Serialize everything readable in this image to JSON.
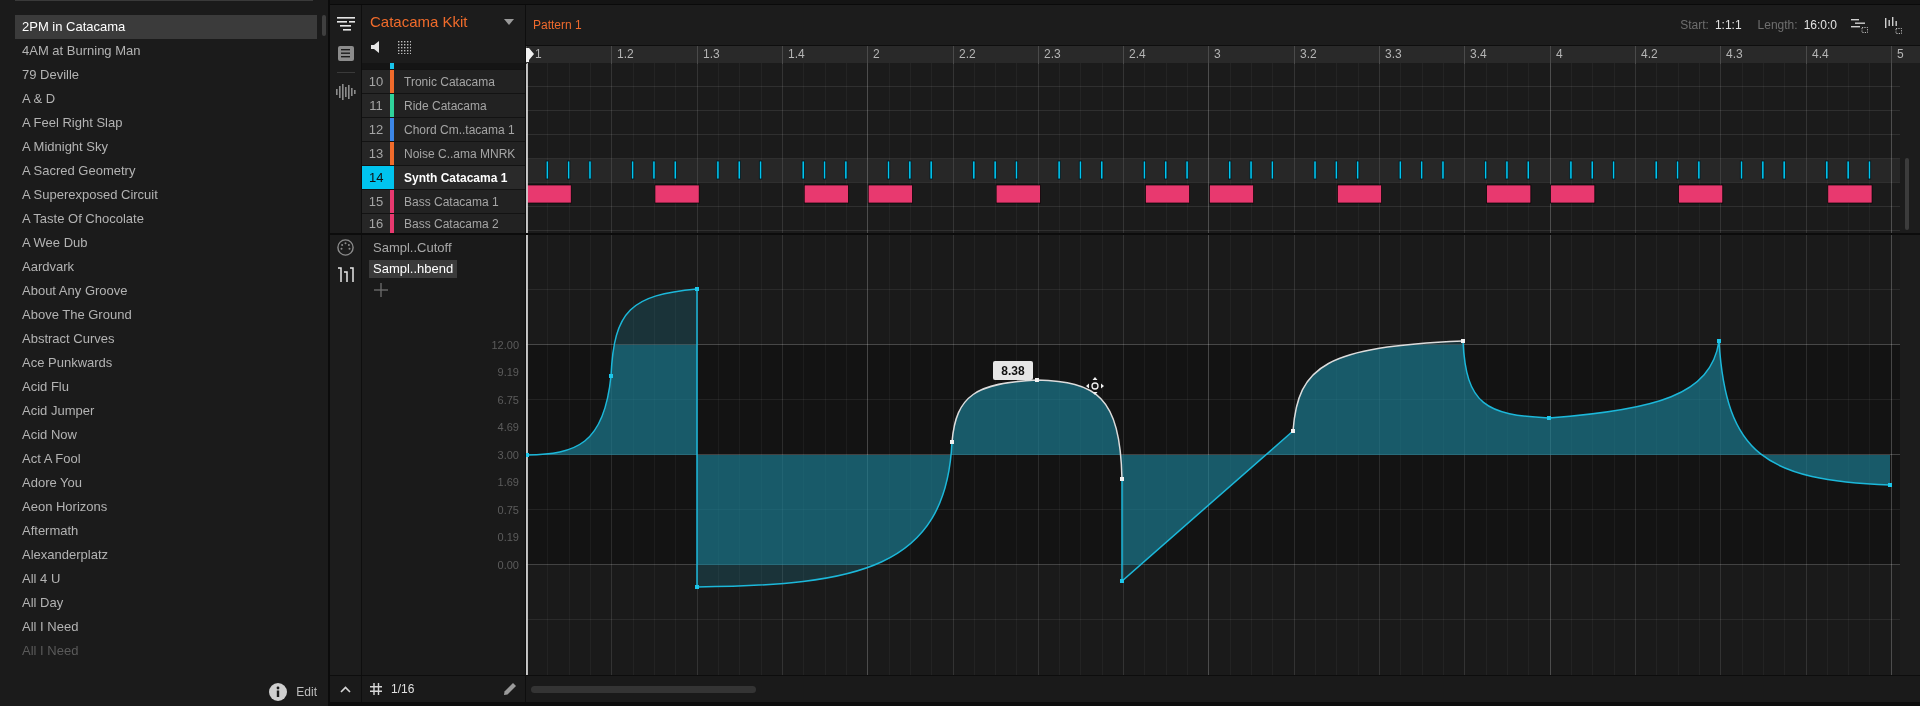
{
  "browser": {
    "items": [
      {
        "label": "2PM in Catacama",
        "selected": true,
        "faded": false
      },
      {
        "label": "4AM at Burning Man",
        "selected": false,
        "faded": false
      },
      {
        "label": "79 Deville",
        "selected": false,
        "faded": false
      },
      {
        "label": "A & D",
        "selected": false,
        "faded": false
      },
      {
        "label": "A Feel Right Slap",
        "selected": false,
        "faded": false
      },
      {
        "label": "A Midnight Sky",
        "selected": false,
        "faded": false
      },
      {
        "label": "A Sacred Geometry",
        "selected": false,
        "faded": false
      },
      {
        "label": "A Superexposed Circuit",
        "selected": false,
        "faded": false
      },
      {
        "label": "A Taste Of Chocolate",
        "selected": false,
        "faded": false
      },
      {
        "label": "A Wee Dub",
        "selected": false,
        "faded": false
      },
      {
        "label": "Aardvark",
        "selected": false,
        "faded": false
      },
      {
        "label": "About Any Groove",
        "selected": false,
        "faded": false
      },
      {
        "label": "Above The Ground",
        "selected": false,
        "faded": false
      },
      {
        "label": "Abstract Curves",
        "selected": false,
        "faded": false
      },
      {
        "label": "Ace Punkwards",
        "selected": false,
        "faded": false
      },
      {
        "label": "Acid Flu",
        "selected": false,
        "faded": false
      },
      {
        "label": "Acid Jumper",
        "selected": false,
        "faded": false
      },
      {
        "label": "Acid Now",
        "selected": false,
        "faded": false
      },
      {
        "label": "Act A Fool",
        "selected": false,
        "faded": false
      },
      {
        "label": "Adore You",
        "selected": false,
        "faded": false
      },
      {
        "label": "Aeon Horizons",
        "selected": false,
        "faded": false
      },
      {
        "label": "Aftermath",
        "selected": false,
        "faded": false
      },
      {
        "label": "Alexanderplatz",
        "selected": false,
        "faded": false
      },
      {
        "label": "All 4 U",
        "selected": false,
        "faded": false
      },
      {
        "label": "All Day",
        "selected": false,
        "faded": false
      },
      {
        "label": "All I Need",
        "selected": false,
        "faded": false
      },
      {
        "label": "All I Need",
        "selected": false,
        "faded": true
      }
    ],
    "edit": "Edit"
  },
  "views": [
    {
      "selected": true
    },
    {
      "selected": false
    },
    {
      "selected": false
    }
  ],
  "kit": {
    "name": "Catacama Kkit"
  },
  "clipped_track": {
    "color": "#18c3ea"
  },
  "tracks": [
    {
      "number": "10",
      "name": "Tronic Catacama",
      "color": "#f06b2b",
      "selected": false
    },
    {
      "number": "11",
      "name": "Ride Catacama",
      "color": "#2fd39b",
      "selected": false
    },
    {
      "number": "12",
      "name": "Chord Cm..tacama 1",
      "color": "#3c86e6",
      "selected": false
    },
    {
      "number": "13",
      "name": "Noise C..ama MNRK",
      "color": "#f06b2b",
      "selected": false
    },
    {
      "number": "14",
      "name": "Synth Catacama 1",
      "color": "#00c4ef",
      "selected": true
    },
    {
      "number": "15",
      "name": "Bass Catacama 1",
      "color": "#e8396f",
      "selected": false
    },
    {
      "number": "16",
      "name": "Bass Catacama 2",
      "color": "#e8396f",
      "selected": false
    }
  ],
  "pattern": {
    "name": "Pattern 1",
    "start_label": "Start:",
    "start": "1:1:1",
    "length_label": "Length:",
    "length": "16:0:0"
  },
  "ruler": [
    "1",
    "1.2",
    "1.3",
    "1.4",
    "2",
    "2.2",
    "2.3",
    "2.4",
    "3",
    "3.2",
    "3.3",
    "3.4",
    "4",
    "4.2",
    "4.3",
    "4.4",
    "5"
  ],
  "modes": [
    {
      "selected": false
    },
    {
      "selected": true
    }
  ],
  "automation": {
    "parameters": [
      {
        "label": "Sampl..Cutoff",
        "selected": false
      },
      {
        "label": "Sampl..hbend",
        "selected": true
      }
    ],
    "value_labels": [
      "12.00",
      "9.19",
      "6.75",
      "4.69",
      "3.00",
      "1.69",
      "0.75",
      "0.19",
      "0.00"
    ],
    "tooltip": "8.38"
  },
  "footer": {
    "grid": "1/16"
  }
}
